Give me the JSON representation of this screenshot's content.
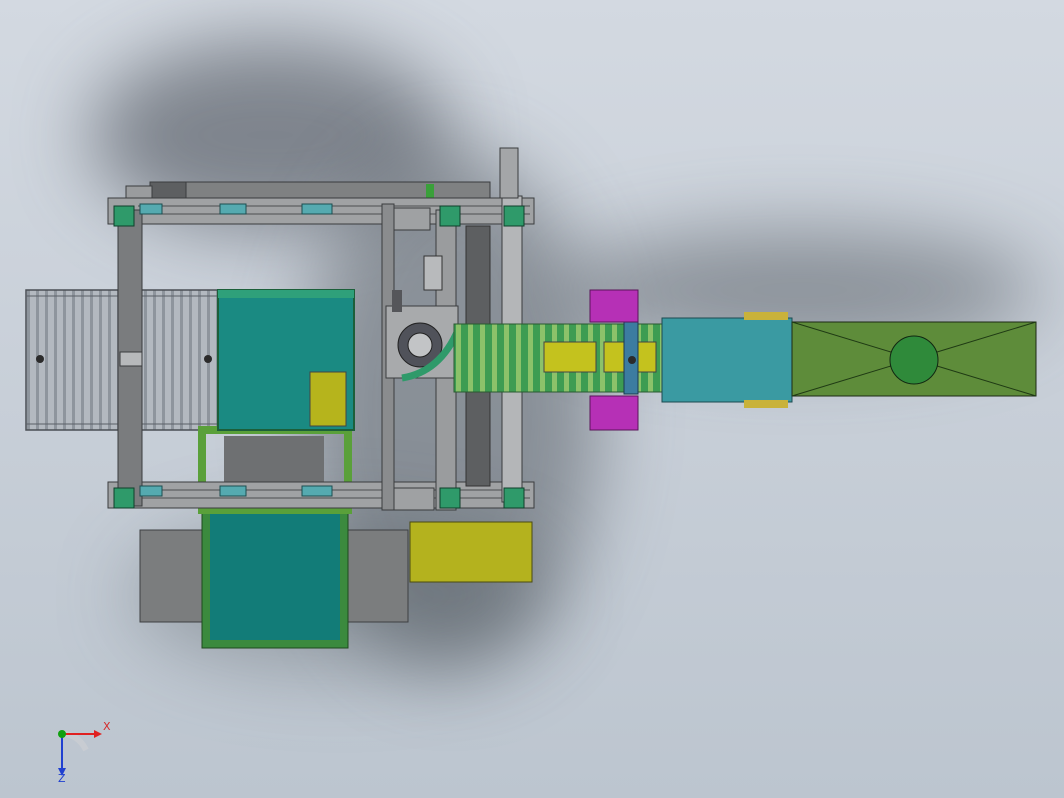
{
  "viewport": {
    "background": "#c9d0d9",
    "scene": "machine-assembly-top-view"
  },
  "triad": {
    "x_label": "X",
    "z_label": "Z",
    "x_color": "#e02020",
    "y_color": "#10a010",
    "z_color": "#2040d0"
  },
  "colors": {
    "frame": "#7d7f80",
    "frame_dark": "#4f5151",
    "teal": "#147f7a",
    "olive": "#a8a814",
    "green": "#3c9a3c",
    "magenta": "#b42cb4",
    "cyan_box": "#3a9aa0",
    "olive_green": "#5e8a3a",
    "roller": "#a7adb4"
  }
}
